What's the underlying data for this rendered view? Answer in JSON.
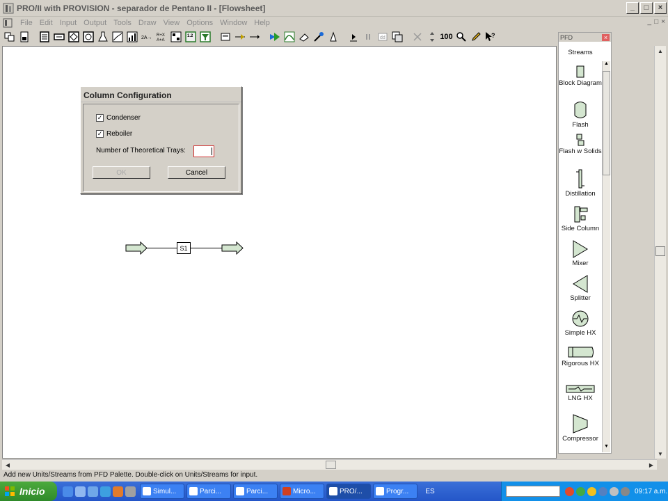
{
  "window": {
    "title": "PRO/II with PROVISION - separador de Pentano II - [Flowsheet]",
    "controls": [
      "_",
      "□",
      "×"
    ]
  },
  "menu": {
    "items": [
      "File",
      "Edit",
      "Input",
      "Output",
      "Tools",
      "Draw",
      "View",
      "Options",
      "Window",
      "Help"
    ],
    "mdi_controls": [
      "_",
      "□",
      "×"
    ]
  },
  "toolbar": {
    "icons": [
      "new-flowsheet-icon",
      "save-icon",
      "component-selection-icon",
      "thermo-icon",
      "units-icon",
      "problem-description-icon",
      "assays-icon",
      "plot-icon",
      "chart-icon",
      "reaction-icon",
      "procedure-icon",
      "stream-data-icon",
      "calc-sequence-icon",
      "zoom-icon",
      "filter-icon",
      "arrow-icon",
      "run-icon",
      "curve-icon",
      "eraser-icon",
      "wrench-icon",
      "wizard-icon",
      "play-icon",
      "pause-icon",
      "step-icon",
      "copy-icon",
      "delete-icon",
      "adjust-icon",
      "zoom-100-icon",
      "magnify-icon",
      "pencil-icon",
      "help-cursor-icon"
    ],
    "zoom_label": "100"
  },
  "pfd_palette": {
    "title": "PFD",
    "items": [
      {
        "label": "Streams",
        "icon": "streams-icon"
      },
      {
        "label": "Block Diagram",
        "icon": "block-diagram-icon"
      },
      {
        "label": "Flash",
        "icon": "flash-drum-icon"
      },
      {
        "label": "Flash w Solids",
        "icon": "flash-solids-icon"
      },
      {
        "label": "Distillation",
        "icon": "distillation-icon"
      },
      {
        "label": "Side Column",
        "icon": "side-column-icon"
      },
      {
        "label": "Mixer",
        "icon": "mixer-icon"
      },
      {
        "label": "Splitter",
        "icon": "splitter-icon"
      },
      {
        "label": "Simple HX",
        "icon": "simple-hx-icon"
      },
      {
        "label": "Rigorous HX",
        "icon": "rigorous-hx-icon"
      },
      {
        "label": "LNG HX",
        "icon": "lng-hx-icon"
      },
      {
        "label": "Compressor",
        "icon": "compressor-icon"
      }
    ]
  },
  "dialog": {
    "title": "Column Configuration",
    "condenser_label": "Condenser",
    "condenser_checked": true,
    "reboiler_label": "Reboiler",
    "reboiler_checked": true,
    "trays_label": "Number of Theoretical Trays:",
    "trays_value": "",
    "ok_label": "OK",
    "cancel_label": "Cancel"
  },
  "flowsheet": {
    "stream_label": "S1",
    "stream_fill": "#d4e6d0"
  },
  "statusbar": {
    "text": "Add new Units/Streams from PFD Palette.  Double-click on Units/Streams for input."
  },
  "taskbar": {
    "start_label": "Inicio",
    "tasks": [
      {
        "label": "Simul...",
        "active": false
      },
      {
        "label": "Parci...",
        "active": false
      },
      {
        "label": "Parci...",
        "active": false
      },
      {
        "label": "Micro...",
        "active": false
      },
      {
        "label": "PRO/...",
        "active": true
      },
      {
        "label": "Progr...",
        "active": false
      }
    ],
    "language": "ES",
    "clock": "09:17 a.m."
  }
}
